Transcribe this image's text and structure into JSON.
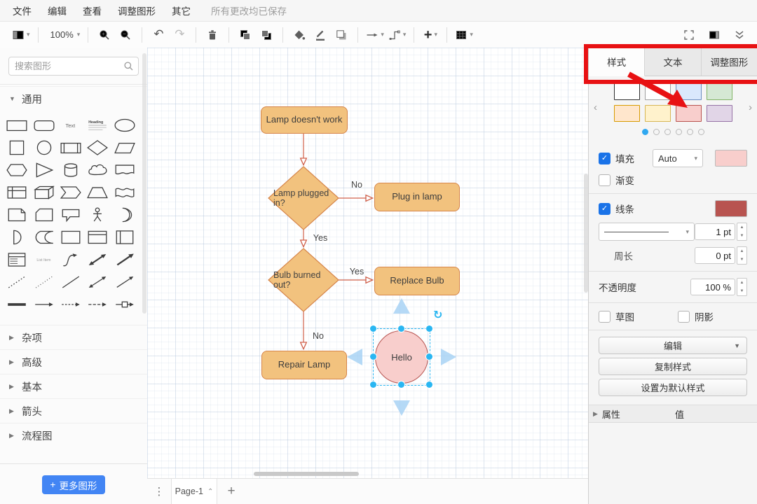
{
  "menubar": {
    "items": [
      "文件",
      "编辑",
      "查看",
      "调整图形",
      "其它"
    ],
    "status": "所有更改均已保存"
  },
  "toolbar": {
    "zoom_level": "100%",
    "icons": [
      "view-panels",
      "zoom-in",
      "zoom-out",
      "undo",
      "redo",
      "delete",
      "to-front",
      "to-back",
      "fill-color",
      "line-color",
      "shadow",
      "connection",
      "waypoints",
      "insert",
      "table",
      "fullscreen",
      "format-panel",
      "collapse"
    ]
  },
  "sidebar": {
    "search_placeholder": "搜索图形",
    "sections": [
      {
        "label": "通用",
        "expanded": true
      },
      {
        "label": "杂项",
        "expanded": false
      },
      {
        "label": "高级",
        "expanded": false
      },
      {
        "label": "基本",
        "expanded": false
      },
      {
        "label": "箭头",
        "expanded": false
      },
      {
        "label": "流程图",
        "expanded": false
      }
    ],
    "shapes": [
      "rectangle",
      "rounded-rectangle",
      "text",
      "heading",
      "ellipse",
      "square",
      "circle",
      "process",
      "diamond",
      "parallelogram",
      "hexagon",
      "triangle",
      "cylinder",
      "cloud",
      "document",
      "internal-storage",
      "cube",
      "step",
      "trapezoid",
      "tape",
      "note",
      "card",
      "callout",
      "actor",
      "or",
      "and",
      "data-storage",
      "container",
      "container-title",
      "vertical-container",
      "list",
      "list-item",
      "curve",
      "bidirectional-arrow",
      "directional-arrow",
      "dashed-line",
      "dotted-line",
      "line",
      "bidirectional-connector",
      "directional-connector",
      "link",
      "arrow",
      "dashed-arrow",
      "dashed-arrow-2",
      "arrow-with-box"
    ],
    "more_shapes": {
      "plus": "+",
      "label": "更多图形"
    }
  },
  "canvas": {
    "nodes": [
      {
        "id": "start",
        "label": "Lamp doesn't work",
        "type": "rounded-rectangle"
      },
      {
        "id": "decision1",
        "label": "Lamp plugged in?",
        "type": "diamond"
      },
      {
        "id": "plug",
        "label": "Plug in lamp",
        "type": "rounded-rectangle"
      },
      {
        "id": "decision2",
        "label": "Bulb burned out?",
        "type": "diamond"
      },
      {
        "id": "replace",
        "label": "Replace Bulb",
        "type": "rounded-rectangle"
      },
      {
        "id": "repair",
        "label": "Repair Lamp",
        "type": "rounded-rectangle"
      },
      {
        "id": "hello",
        "label": "Hello",
        "type": "ellipse",
        "selected": true
      }
    ],
    "edges": [
      {
        "from": "decision1",
        "to": "plug",
        "label": "No"
      },
      {
        "from": "decision1",
        "to": "decision2",
        "label": "Yes"
      },
      {
        "from": "decision2",
        "to": "replace",
        "label": "Yes"
      },
      {
        "from": "decision2",
        "to": "repair",
        "label": "No"
      }
    ],
    "page_tab": "Page-1"
  },
  "format_panel": {
    "tabs": [
      {
        "label": "样式",
        "active": true
      },
      {
        "label": "文本",
        "active": false
      },
      {
        "label": "调整图形",
        "active": false
      }
    ],
    "swatches": [
      {
        "fill": "#ffffff",
        "stroke": "#2d2d2d"
      },
      {
        "fill": "#ffffff",
        "stroke": "#a0a0a0"
      },
      {
        "fill": "#dae8fc",
        "stroke": "#6c8ebf"
      },
      {
        "fill": "#d5e8d4",
        "stroke": "#82b366"
      },
      {
        "fill": "#ffe6cc",
        "stroke": "#d79b00"
      },
      {
        "fill": "#fff2cc",
        "stroke": "#d6b656"
      },
      {
        "fill": "#f8cecc",
        "stroke": "#b85450"
      },
      {
        "fill": "#e1d5e7",
        "stroke": "#9673a6"
      }
    ],
    "pager": {
      "count": 6,
      "active": 0
    },
    "fill": {
      "label": "填充",
      "checked": true,
      "mode": "Auto",
      "color": "#f8cecc"
    },
    "gradient": {
      "label": "渐变",
      "checked": false
    },
    "line": {
      "label": "线条",
      "checked": true,
      "color": "#b85450",
      "width": "1 pt"
    },
    "perimeter": {
      "label": "周长",
      "value": "0 pt"
    },
    "opacity": {
      "label": "不透明度",
      "value": "100 %"
    },
    "sketch": {
      "label": "草图",
      "checked": false
    },
    "shadow": {
      "label": "阴影",
      "checked": false
    },
    "buttons": {
      "edit": "编辑",
      "copy_style": "复制样式",
      "set_default": "设置为默认样式"
    },
    "properties": {
      "label": "属性",
      "value_label": "值"
    }
  },
  "colors": {
    "node_fill": "#f2c27e",
    "node_stroke": "#d6854a",
    "edge": "#d0604a",
    "selected_fill": "#f8cecc",
    "selected_stroke": "#b85450",
    "handle": "#29b6f2",
    "pale_arrow": "#a9d3f5",
    "accent_blue": "#4285f4",
    "active_dot": "#30a8f0",
    "annotation": "#e81113"
  }
}
